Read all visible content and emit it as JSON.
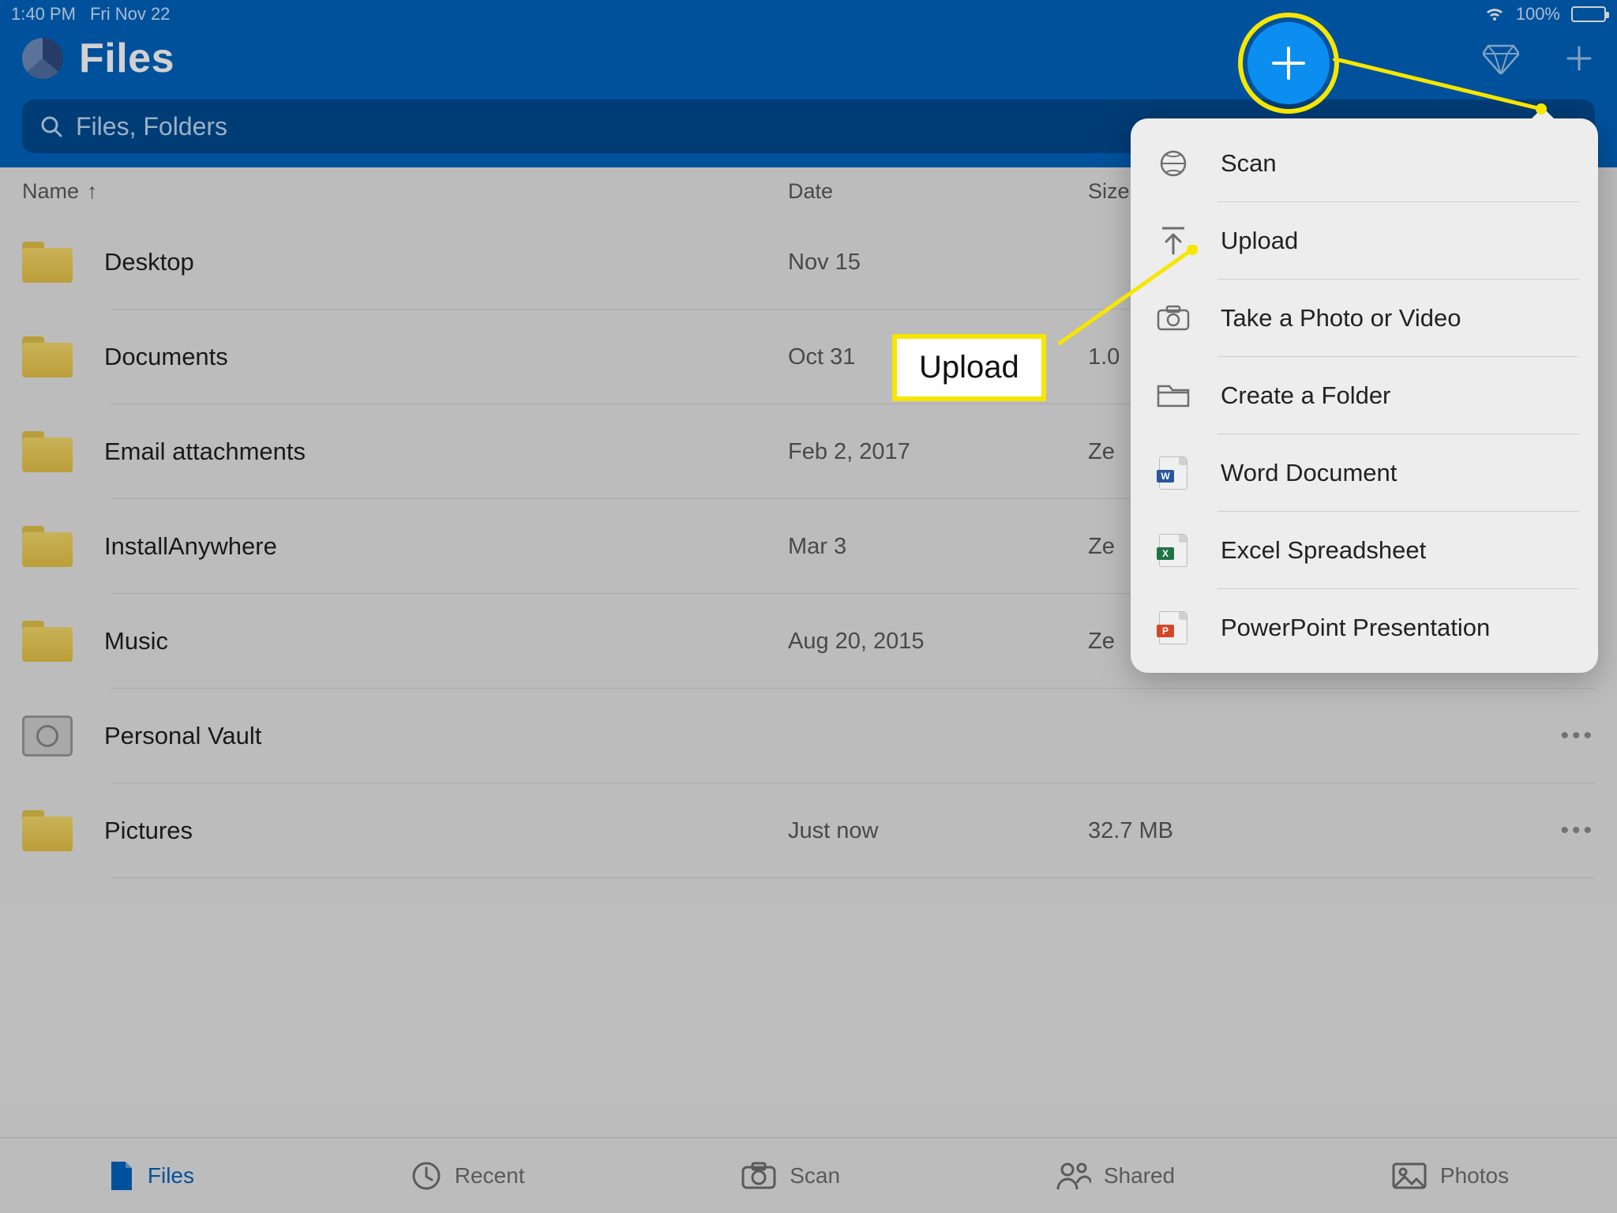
{
  "status": {
    "time": "1:40 PM",
    "date": "Fri Nov 22",
    "battery_pct": "100%"
  },
  "header": {
    "title": "Files"
  },
  "search": {
    "placeholder": "Files, Folders"
  },
  "columns": {
    "name": "Name",
    "date": "Date",
    "size": "Size"
  },
  "rows": [
    {
      "icon": "folder",
      "name": "Desktop",
      "date": "Nov 15",
      "size": "",
      "more": false
    },
    {
      "icon": "folder",
      "name": "Documents",
      "date": "Oct 31",
      "size": "1.0",
      "more": false
    },
    {
      "icon": "folder",
      "name": "Email attachments",
      "date": "Feb 2, 2017",
      "size": "Ze",
      "more": false
    },
    {
      "icon": "folder",
      "name": "InstallAnywhere",
      "date": "Mar 3",
      "size": "Ze",
      "more": false
    },
    {
      "icon": "folder",
      "name": "Music",
      "date": "Aug 20, 2015",
      "size": "Ze",
      "more": false
    },
    {
      "icon": "vault",
      "name": "Personal Vault",
      "date": "",
      "size": "",
      "more": true
    },
    {
      "icon": "folder",
      "name": "Pictures",
      "date": "Just now",
      "size": "32.7 MB",
      "more": true
    }
  ],
  "popover": [
    {
      "icon": "scan",
      "label": "Scan"
    },
    {
      "icon": "upload",
      "label": "Upload"
    },
    {
      "icon": "camera",
      "label": "Take a Photo or Video"
    },
    {
      "icon": "folder",
      "label": "Create a Folder"
    },
    {
      "icon": "word",
      "label": "Word Document"
    },
    {
      "icon": "excel",
      "label": "Excel Spreadsheet"
    },
    {
      "icon": "ppt",
      "label": "PowerPoint Presentation"
    }
  ],
  "tabs": [
    {
      "icon": "files",
      "label": "Files",
      "active": true
    },
    {
      "icon": "recent",
      "label": "Recent",
      "active": false
    },
    {
      "icon": "scan",
      "label": "Scan",
      "active": false
    },
    {
      "icon": "shared",
      "label": "Shared",
      "active": false
    },
    {
      "icon": "photos",
      "label": "Photos",
      "active": false
    }
  ],
  "annotation": {
    "upload_label": "Upload"
  }
}
